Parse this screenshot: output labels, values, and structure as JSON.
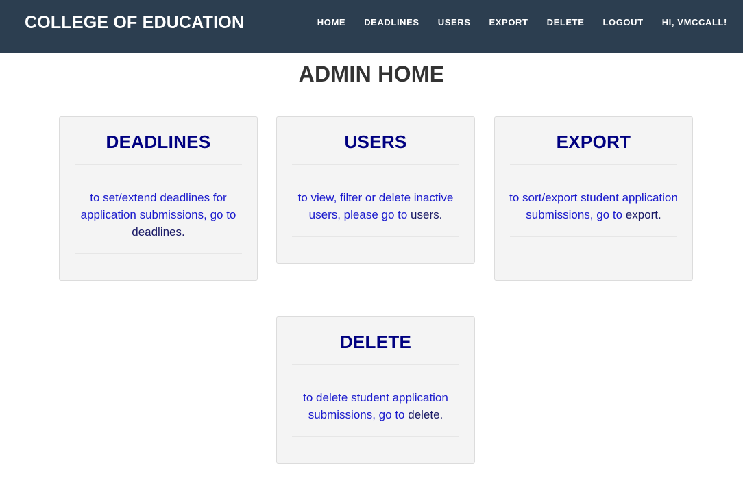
{
  "header": {
    "brand": "COLLEGE OF EDUCATION",
    "nav": [
      "HOME",
      "DEADLINES",
      "USERS",
      "EXPORT",
      "DELETE",
      "LOGOUT",
      "HI, VMCCALL!"
    ]
  },
  "page": {
    "title": "ADMIN HOME"
  },
  "cards": {
    "deadlines": {
      "title": "DEADLINES",
      "text": "to set/extend deadlines for application submissions, go to",
      "link": "deadlines."
    },
    "users": {
      "title": "USERS",
      "text": "to view, filter or delete inactive users, please go to",
      "link": "users."
    },
    "export": {
      "title": "EXPORT",
      "text": "to sort/export student application submissions, go to",
      "link": "export."
    },
    "delete": {
      "title": "DELETE",
      "text": "to delete student application submissions, go to",
      "link": "delete."
    }
  },
  "colors": {
    "navbar": "#2c3e50",
    "card_title": "#000080",
    "card_text": "#1a1acd"
  }
}
